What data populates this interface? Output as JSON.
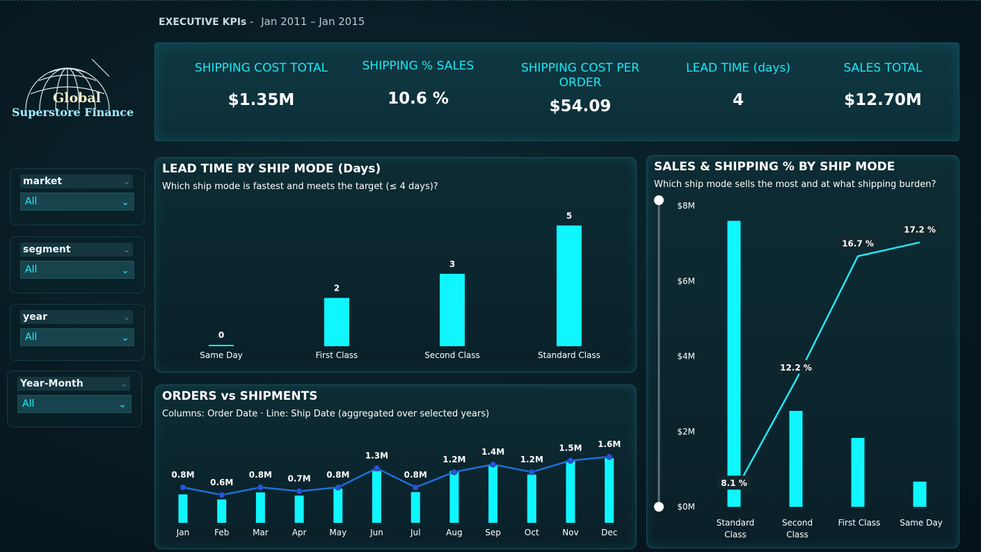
{
  "header": {
    "title": "EXECUTIVE KPIs",
    "separator": "-",
    "period": "Jan 2011 – Jan 2015"
  },
  "logo": {
    "line1": "Global",
    "line2": "Superstore Finance"
  },
  "filters": [
    {
      "label": "market",
      "value": "All"
    },
    {
      "label": "segment",
      "value": "All"
    },
    {
      "label": "year",
      "value": "All"
    },
    {
      "label": "Year-Month",
      "value": "All"
    }
  ],
  "kpis": [
    {
      "label": "SHIPPING COST TOTAL",
      "value": "$1.35M"
    },
    {
      "label": "SHIPPING % SALES",
      "value": "10.6 %"
    },
    {
      "label": "SHIPPING COST PER ORDER",
      "value": "$54.09"
    },
    {
      "label": "LEAD TIME (days)",
      "value": "4"
    },
    {
      "label": "SALES TOTAL",
      "value": "$12.70M"
    }
  ],
  "lead_panel": {
    "title": "LEAD TIME BY SHIP MODE (Days)",
    "subtitle": "Which ship mode is fastest and meets the target (≤ 4 days)?"
  },
  "orders_panel": {
    "title": "ORDERS vs SHIPMENTS",
    "subtitle": "Columns: Order Date · Line: Ship Date (aggregated over selected years)"
  },
  "sales_panel": {
    "title": "SALES & SHIPPING % BY SHIP MODE",
    "subtitle": "Which ship mode sells the most and at what shipping burden?"
  },
  "colors": {
    "accent": "#0ff6ff",
    "line_blue": "#1f6fd8",
    "line_cyan": "#20e8f5",
    "panel": "#0c2a32"
  },
  "chart_data": [
    {
      "type": "bar",
      "categories": [
        "Same Day",
        "First Class",
        "Second Class",
        "Standard Class"
      ],
      "values": [
        0,
        2,
        3,
        5
      ],
      "data_labels": [
        "0",
        "2",
        "3",
        "5"
      ],
      "ylim": [
        0,
        5.5
      ]
    },
    {
      "type": "bar",
      "categories": [
        "Jan",
        "Feb",
        "Mar",
        "Apr",
        "May",
        "Jun",
        "Jul",
        "Aug",
        "Sep",
        "Oct",
        "Nov",
        "Dec"
      ],
      "series": [
        {
          "kind": "column",
          "values": [
            0.73,
            0.6,
            0.78,
            0.7,
            0.88,
            1.33,
            0.79,
            1.33,
            1.5,
            1.24,
            1.6,
            1.66
          ]
        },
        {
          "kind": "line",
          "values": [
            0.8,
            0.6,
            0.8,
            0.7,
            0.8,
            1.3,
            0.8,
            1.2,
            1.4,
            1.2,
            1.5,
            1.6
          ]
        }
      ],
      "data_labels": [
        "0.8M",
        "0.6M",
        "0.8M",
        "0.7M",
        "0.8M",
        "1.3M",
        "0.8M",
        "1.2M",
        "1.4M",
        "1.2M",
        "1.5M",
        "1.6M"
      ],
      "ylim": [
        0,
        2.2
      ]
    },
    {
      "type": "bar",
      "categories": [
        "Standard Class",
        "Second Class",
        "First Class",
        "Same Day"
      ],
      "tick_labels": [
        [
          "Standard",
          "Class"
        ],
        [
          "Second",
          "Class"
        ],
        [
          "First Class"
        ],
        [
          "Same Day"
        ]
      ],
      "series": [
        {
          "kind": "column",
          "values": [
            7.6,
            2.55,
            1.83,
            0.67
          ]
        },
        {
          "kind": "line",
          "values": [
            8.1,
            12.2,
            16.7,
            17.2
          ]
        }
      ],
      "line_labels": [
        "8.1 %",
        "12.2 %",
        "16.7 %",
        "17.2 %"
      ],
      "y_ticks": [
        "$0M",
        "$2M",
        "$4M",
        "$6M",
        "$8M"
      ],
      "ylim": [
        0,
        8
      ],
      "y2lim": [
        7.6,
        18.0
      ]
    }
  ]
}
